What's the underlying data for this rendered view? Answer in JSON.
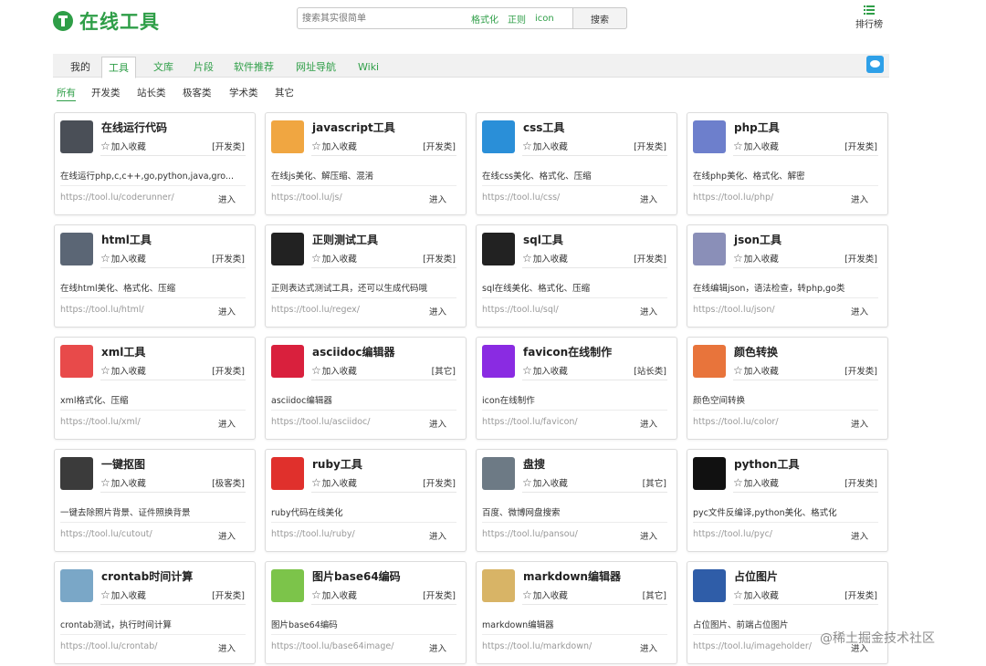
{
  "header": {
    "logo_text": "在线工具",
    "search_placeholder": "搜索其实很简单",
    "search_tags": [
      "格式化",
      "正则",
      "icon"
    ],
    "search_button": "搜索",
    "rank_label": "排行榜"
  },
  "nav": {
    "tabs": [
      "我的",
      "工具",
      "文库",
      "片段",
      "软件推荐",
      "网址导航",
      "Wiki"
    ],
    "active_index": 1
  },
  "categories": [
    "所有",
    "开发类",
    "站长类",
    "极客类",
    "学术类",
    "其它"
  ],
  "fav_label": "加入收藏",
  "enter_label": "进入",
  "tools": [
    {
      "title": "在线运行代码",
      "category": "[开发类]",
      "desc": "在线运行php,c,c++,go,python,java,gro...",
      "url": "https://tool.lu/coderunner/",
      "icon": "monitor-code-icon",
      "color": "#4a4f57"
    },
    {
      "title": "javascript工具",
      "category": "[开发类]",
      "desc": "在线js美化、解压缩、混淆",
      "url": "https://tool.lu/js/",
      "icon": "js-file-icon",
      "color": "#f0a641"
    },
    {
      "title": "css工具",
      "category": "[开发类]",
      "desc": "在线css美化、格式化、压缩",
      "url": "https://tool.lu/css/",
      "icon": "css-file-icon",
      "color": "#2a8fd8"
    },
    {
      "title": "php工具",
      "category": "[开发类]",
      "desc": "在线php美化、格式化、解密",
      "url": "https://tool.lu/php/",
      "icon": "php-file-icon",
      "color": "#6d7fcc"
    },
    {
      "title": "html工具",
      "category": "[开发类]",
      "desc": "在线html美化、格式化、压缩",
      "url": "https://tool.lu/html/",
      "icon": "html-code-icon",
      "color": "#5b6675"
    },
    {
      "title": "正则测试工具",
      "category": "[开发类]",
      "desc": "正则表达式测试工具，还可以生成代码哦",
      "url": "https://tool.lu/regex/",
      "icon": "regex-icon",
      "color": "#222222"
    },
    {
      "title": "sql工具",
      "category": "[开发类]",
      "desc": "sql在线美化、格式化、压缩",
      "url": "https://tool.lu/sql/",
      "icon": "sql-icon",
      "color": "#222222"
    },
    {
      "title": "json工具",
      "category": "[开发类]",
      "desc": "在线编辑json，语法检查，转php,go类",
      "url": "https://tool.lu/json/",
      "icon": "json-file-icon",
      "color": "#8a8fb8"
    },
    {
      "title": "xml工具",
      "category": "[开发类]",
      "desc": "xml格式化、压缩",
      "url": "https://tool.lu/xml/",
      "icon": "xml-file-icon",
      "color": "#e84a4a"
    },
    {
      "title": "asciidoc编辑器",
      "category": "[其它]",
      "desc": "asciidoc编辑器",
      "url": "https://tool.lu/asciidoc/",
      "icon": "asciidoc-icon",
      "color": "#d9203d"
    },
    {
      "title": "favicon在线制作",
      "category": "[站长类]",
      "desc": "icon在线制作",
      "url": "https://tool.lu/favicon/",
      "icon": "instagram-icon",
      "color": "#8a2be2"
    },
    {
      "title": "颜色转换",
      "category": "[开发类]",
      "desc": "颜色空间转换",
      "url": "https://tool.lu/color/",
      "icon": "color-palette-icon",
      "color": "#e8743b"
    },
    {
      "title": "一键抠图",
      "category": "[极客类]",
      "desc": "一键去除照片背景、证件照换背景",
      "url": "https://tool.lu/cutout/",
      "icon": "portrait-icon",
      "color": "#3b3b3b"
    },
    {
      "title": "ruby工具",
      "category": "[开发类]",
      "desc": "ruby代码在线美化",
      "url": "https://tool.lu/ruby/",
      "icon": "ruby-gem-icon",
      "color": "#e0302c"
    },
    {
      "title": "盘搜",
      "category": "[其它]",
      "desc": "百度、微博网盘搜索",
      "url": "https://tool.lu/pansou/",
      "icon": "hard-disk-icon",
      "color": "#6d7a85"
    },
    {
      "title": "python工具",
      "category": "[开发类]",
      "desc": "pyc文件反编译,python美化、格式化",
      "url": "https://tool.lu/pyc/",
      "icon": "python-icon",
      "color": "#111111"
    },
    {
      "title": "crontab时间计算",
      "category": "[开发类]",
      "desc": "crontab测试，执行时间计算",
      "url": "https://tool.lu/crontab/",
      "icon": "crontab-icon",
      "color": "#7aa7c7"
    },
    {
      "title": "图片base64编码",
      "category": "[开发类]",
      "desc": "图片base64编码",
      "url": "https://tool.lu/base64image/",
      "icon": "image-file-icon",
      "color": "#7cc44a"
    },
    {
      "title": "markdown编辑器",
      "category": "[其它]",
      "desc": "markdown编辑器",
      "url": "https://tool.lu/markdown/",
      "icon": "notepad-icon",
      "color": "#d8b466"
    },
    {
      "title": "占位图片",
      "category": "[开发类]",
      "desc": "占位图片、前端占位图片",
      "url": "https://tool.lu/imageholder/",
      "icon": "placeholder-image-icon",
      "color": "#2f5da8"
    }
  ],
  "watermark": "@稀土掘金技术社区"
}
